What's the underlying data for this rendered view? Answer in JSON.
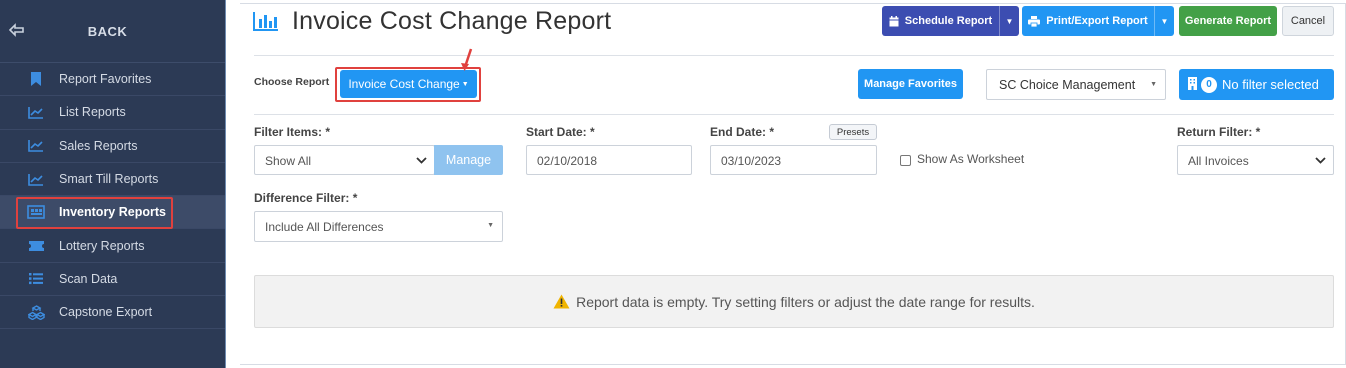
{
  "sidebar": {
    "back_label": "BACK",
    "items": [
      {
        "label": "Report Favorites",
        "icon": "bookmark-icon"
      },
      {
        "label": "List Reports",
        "icon": "line-chart-icon"
      },
      {
        "label": "Sales Reports",
        "icon": "line-chart-icon"
      },
      {
        "label": "Smart Till Reports",
        "icon": "line-chart-icon"
      },
      {
        "label": "Inventory Reports",
        "icon": "inventory-icon",
        "active": true
      },
      {
        "label": "Lottery Reports",
        "icon": "ticket-icon"
      },
      {
        "label": "Scan Data",
        "icon": "list-icon"
      },
      {
        "label": "Capstone Export",
        "icon": "cubes-icon"
      }
    ]
  },
  "header": {
    "title": "Invoice Cost Change Report",
    "schedule_label": "Schedule Report",
    "print_label": "Print/Export Report",
    "generate_label": "Generate Report",
    "cancel_label": "Cancel"
  },
  "choose": {
    "label": "Choose Report",
    "current": "Invoice Cost Change",
    "manage_favorites": "Manage Favorites",
    "store": "SC Choice Management",
    "filter_count": "0",
    "filter_text": "No filter selected"
  },
  "filters": {
    "filter_items_label": "Filter Items: *",
    "filter_items_value": "Show All",
    "manage_label": "Manage",
    "start_label": "Start Date: *",
    "start_value": "02/10/2018",
    "end_label": "End Date: *",
    "end_value": "03/10/2023",
    "presets_label": "Presets",
    "worksheet_label": "Show As Worksheet",
    "return_label": "Return Filter: *",
    "return_value": "All Invoices",
    "difference_label": "Difference Filter: *",
    "difference_value": "Include All Differences"
  },
  "empty_message": "Report data is empty. Try setting filters or adjust the date range for results.",
  "colors": {
    "sidebar_bg": "#2c3a55",
    "accent_blue": "#2196f3",
    "indigo": "#3c4db1",
    "green": "#43a047",
    "highlight_red": "#e0413e"
  }
}
